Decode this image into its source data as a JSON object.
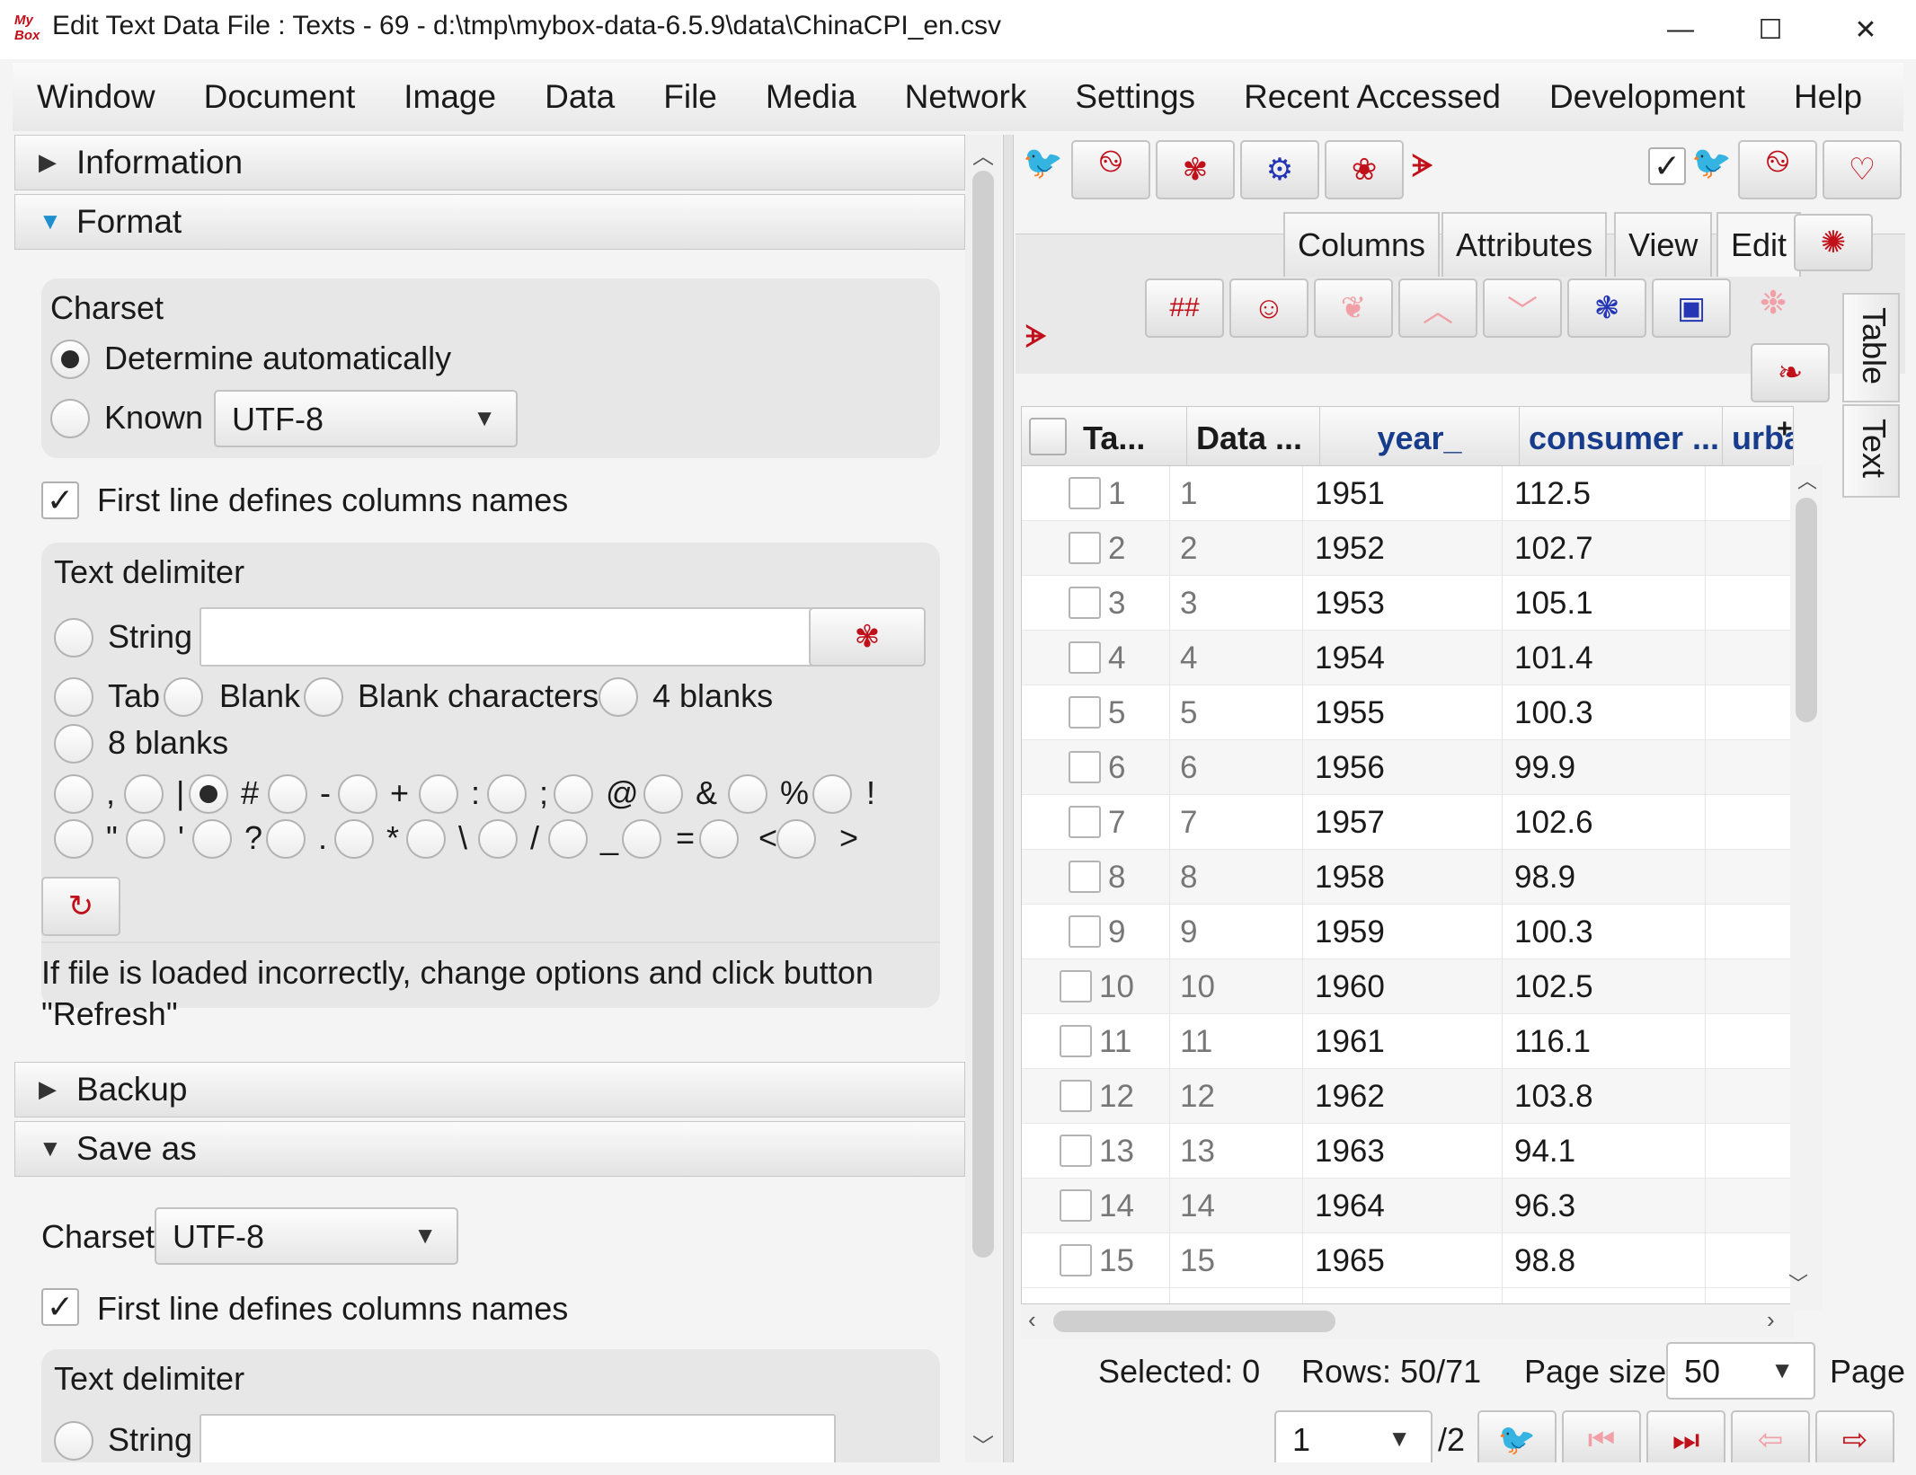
{
  "window": {
    "title": "Edit Text Data File : Texts - 69 - d:\\tmp\\mybox-data-6.5.9\\data\\ChinaCPI_en.csv",
    "logo_top": "My",
    "logo_bottom": "Box",
    "minimize": "—",
    "maximize": "☐",
    "close": "✕"
  },
  "menu": [
    "Window",
    "Document",
    "Image",
    "Data",
    "File",
    "Media",
    "Network",
    "Settings",
    "Recent Accessed",
    "Development",
    "Help"
  ],
  "left": {
    "information_label": "Information",
    "format_label": "Format",
    "charset": {
      "title": "Charset",
      "auto_label": "Determine automatically",
      "known_label": "Known",
      "known_value": "UTF-8"
    },
    "first_line_label": "First line defines columns names",
    "delimiter": {
      "title": "Text delimiter",
      "string_label": "String",
      "tab_label": "Tab",
      "blank_label": "Blank",
      "blank_chars_label": "Blank characters",
      "four_blanks_label": "4 blanks",
      "eight_blanks_label": "8 blanks",
      "symbols_row1": [
        ",",
        "|",
        "#",
        "-",
        "+",
        ":",
        ";",
        "@",
        "&",
        "%",
        "!"
      ],
      "symbols_row2": [
        "\"",
        "'",
        "?",
        ".",
        "*",
        "\\",
        "/",
        "_",
        "=",
        "<",
        ">"
      ],
      "selected_symbol": "#"
    },
    "refresh_hint": "If file is loaded incorrectly, change options and click button \"Refresh\"",
    "backup_label": "Backup",
    "save_as_label": "Save as",
    "save": {
      "charset_label": "Charset",
      "charset_value": "UTF-8",
      "first_line_label": "First line defines columns names",
      "delimiter_title": "Text delimiter",
      "string_label": "String"
    }
  },
  "right": {
    "tabs": [
      "Columns",
      "Attributes",
      "View",
      "Edit"
    ],
    "active_tab": "Edit",
    "side_tabs": [
      "Table",
      "Text"
    ],
    "toolbar_hash": "##",
    "table": {
      "headers": [
        "Ta...",
        "Data ...",
        "year_",
        "consumer ...",
        "urba"
      ],
      "plus": "+",
      "rows": [
        [
          "1",
          "1",
          "1951",
          "112.5"
        ],
        [
          "2",
          "2",
          "1952",
          "102.7"
        ],
        [
          "3",
          "3",
          "1953",
          "105.1"
        ],
        [
          "4",
          "4",
          "1954",
          "101.4"
        ],
        [
          "5",
          "5",
          "1955",
          "100.3"
        ],
        [
          "6",
          "6",
          "1956",
          "99.9"
        ],
        [
          "7",
          "7",
          "1957",
          "102.6"
        ],
        [
          "8",
          "8",
          "1958",
          "98.9"
        ],
        [
          "9",
          "9",
          "1959",
          "100.3"
        ],
        [
          "10",
          "10",
          "1960",
          "102.5"
        ],
        [
          "11",
          "11",
          "1961",
          "116.1"
        ],
        [
          "12",
          "12",
          "1962",
          "103.8"
        ],
        [
          "13",
          "13",
          "1963",
          "94.1"
        ],
        [
          "14",
          "14",
          "1964",
          "96.3"
        ],
        [
          "15",
          "15",
          "1965",
          "98.8"
        ]
      ]
    },
    "status": {
      "selected": "Selected: 0",
      "rows": "Rows: 50/71",
      "page_size_label": "Page size",
      "page_size_value": "50",
      "page_label": "Page",
      "page_value": "1",
      "page_total": "/2"
    }
  }
}
